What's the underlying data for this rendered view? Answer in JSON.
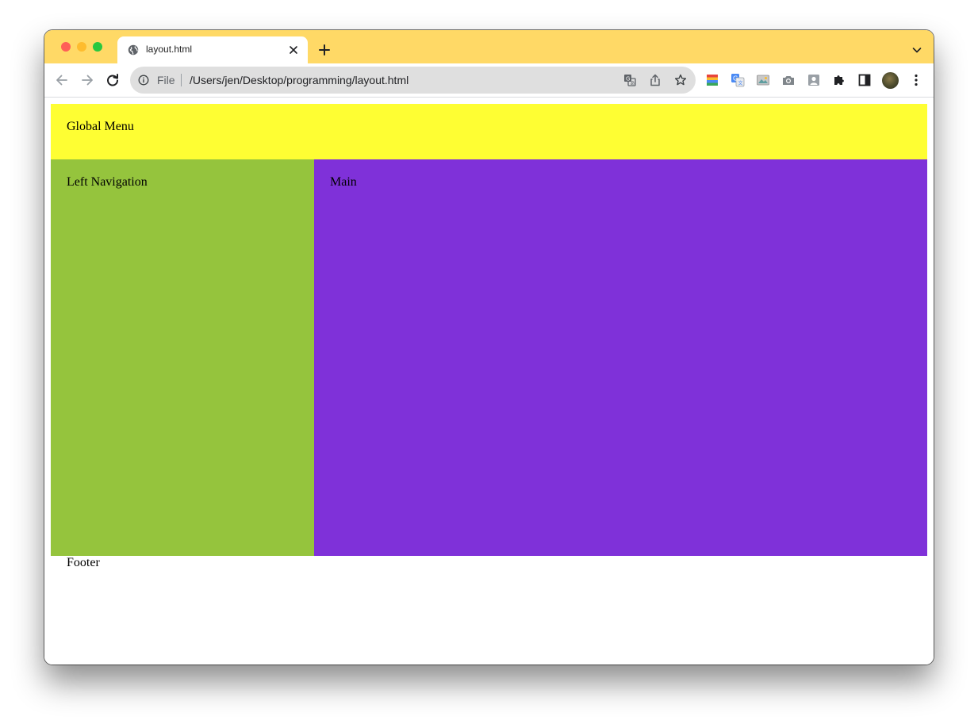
{
  "browser": {
    "tab": {
      "title": "layout.html",
      "favicon": "globe-icon"
    },
    "colors": {
      "tabstrip": "#ffd966"
    },
    "omnibox": {
      "scheme_label": "File",
      "url": "/Users/jen/Desktop/programming/layout.html"
    },
    "icons": {
      "back": "arrow-left-icon",
      "forward": "arrow-right-icon",
      "reload": "reload-icon",
      "info": "info-icon",
      "translate": "translate-icon",
      "share": "share-icon",
      "bookmark": "star-icon",
      "extensions": [
        "color-palette-extension-icon",
        "google-translate-extension-icon",
        "image-extension-icon",
        "camera-extension-icon",
        "profile-card-extension-icon",
        "puzzle-icon",
        "side-panel-icon"
      ],
      "menu": "kebab-menu-icon"
    }
  },
  "page": {
    "global_menu": {
      "label": "Global Menu",
      "color": "#fefe33"
    },
    "left_nav": {
      "label": "Left Navigation",
      "color": "#95c43d"
    },
    "main": {
      "label": "Main",
      "color": "#7f31d9"
    },
    "footer": {
      "label": "Footer"
    }
  }
}
